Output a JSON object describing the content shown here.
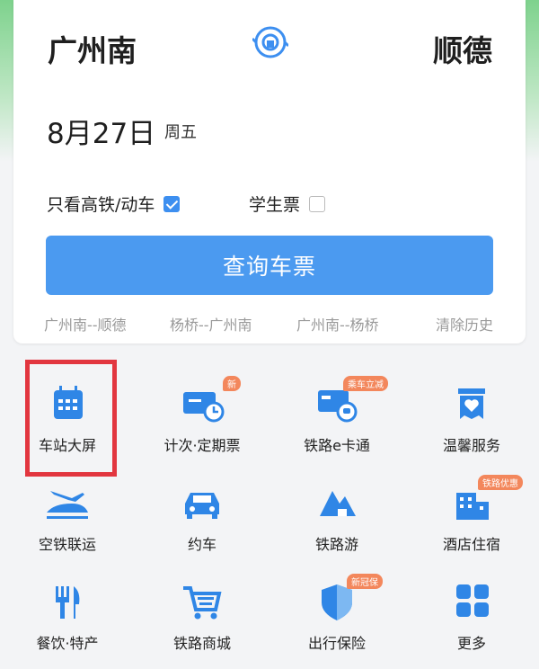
{
  "route": {
    "from": "广州南",
    "to": "顺德"
  },
  "date": {
    "value": "8月27日",
    "weekday": "周五"
  },
  "options": {
    "high_speed_only": {
      "label": "只看高铁/动车",
      "checked": true
    },
    "student_ticket": {
      "label": "学生票",
      "checked": false
    }
  },
  "search_button": "查询车票",
  "history": [
    "广州南--顺德",
    "杨桥--广州南",
    "广州南--杨桥",
    "清除历史"
  ],
  "services": [
    {
      "label": "车站大屏",
      "icon": "calendar-icon",
      "badge": null
    },
    {
      "label": "计次·定期票",
      "icon": "ticket-clock-icon",
      "badge": "新"
    },
    {
      "label": "铁路e卡通",
      "icon": "card-train-icon",
      "badge": "乘车立减"
    },
    {
      "label": "温馨服务",
      "icon": "heart-box-icon",
      "badge": null
    },
    {
      "label": "空铁联运",
      "icon": "plane-train-icon",
      "badge": null
    },
    {
      "label": "约车",
      "icon": "car-icon",
      "badge": null
    },
    {
      "label": "铁路游",
      "icon": "mountain-icon",
      "badge": null
    },
    {
      "label": "酒店住宿",
      "icon": "hotel-icon",
      "badge": "铁路优惠"
    },
    {
      "label": "餐饮·特产",
      "icon": "fork-knife-icon",
      "badge": null
    },
    {
      "label": "铁路商城",
      "icon": "cart-icon",
      "badge": null
    },
    {
      "label": "出行保险",
      "icon": "shield-icon",
      "badge": "新冠保"
    },
    {
      "label": "更多",
      "icon": "grid-icon",
      "badge": null
    }
  ],
  "colors": {
    "accent": "#4b9af0",
    "icon_blue": "#2f86e6",
    "highlight": "#e2363f",
    "badge": "#f3875c"
  }
}
